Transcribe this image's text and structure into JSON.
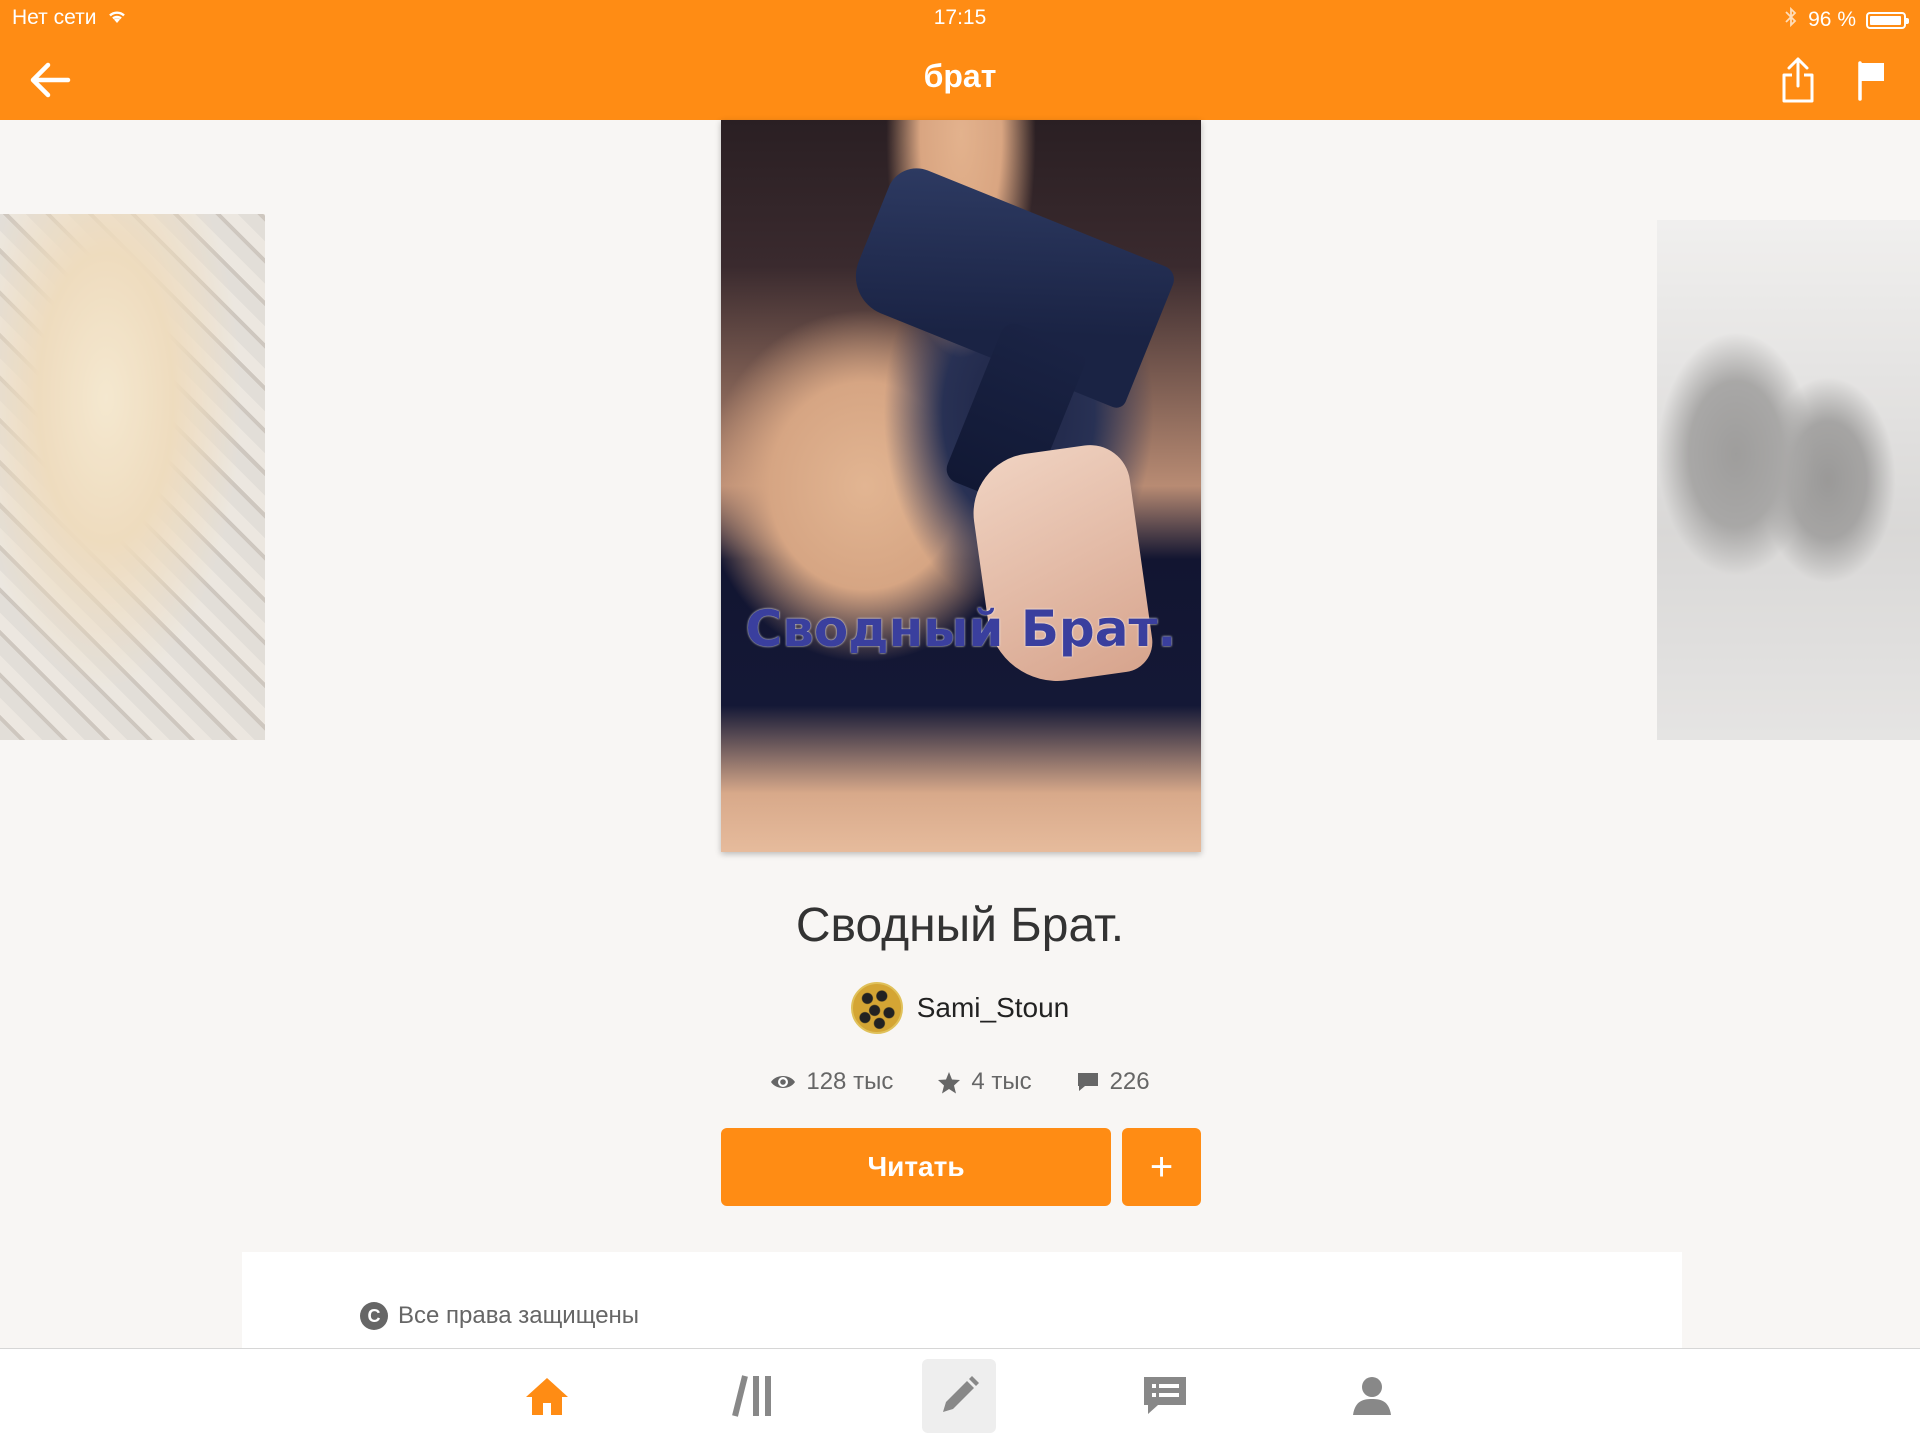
{
  "status_bar": {
    "carrier": "Нет сети",
    "time": "17:15",
    "battery": "96 %",
    "battery_level": 0.96
  },
  "header": {
    "title": "брат"
  },
  "story": {
    "cover_text": "Сводный Брат.",
    "title": "Сводный Брат.",
    "author": "Sami_Stoun",
    "reads": "128 тыс",
    "votes": "4 тыс",
    "comments": "226"
  },
  "actions": {
    "read_label": "Читать",
    "add_label": "+"
  },
  "copyright": {
    "text": "Все права защищены"
  },
  "colors": {
    "accent": "#ff8c14",
    "icon_gray": "#888888"
  },
  "tabs": [
    {
      "icon": "home-icon",
      "active": true
    },
    {
      "icon": "library-icon",
      "active": false
    },
    {
      "icon": "write-icon",
      "active": false
    },
    {
      "icon": "messages-icon",
      "active": false
    },
    {
      "icon": "profile-icon",
      "active": false
    }
  ]
}
